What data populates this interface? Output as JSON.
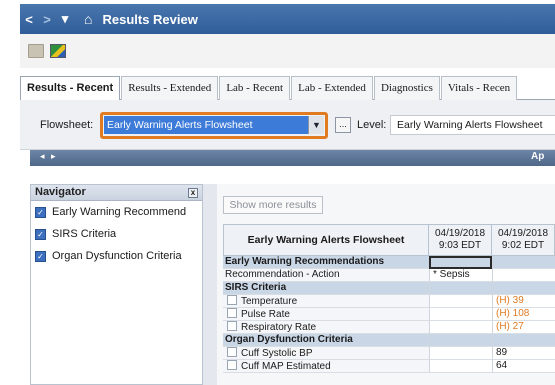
{
  "titlebar": {
    "back_glyph": "<",
    "forward_glyph": ">",
    "menu_glyph": "▾",
    "home_glyph": "⌂",
    "title": "Results Review"
  },
  "tabs": [
    {
      "label": "Results - Recent",
      "active": true
    },
    {
      "label": "Results - Extended",
      "active": false
    },
    {
      "label": "Lab - Recent",
      "active": false
    },
    {
      "label": "Lab - Extended",
      "active": false
    },
    {
      "label": "Diagnostics",
      "active": false
    },
    {
      "label": "Vitals - Recen",
      "active": false
    }
  ],
  "flowsheet": {
    "label": "Flowsheet:",
    "value": "Early Warning Alerts Flowsheet",
    "ellipsis": "...",
    "level_label": "Level:",
    "level_value": "Early Warning Alerts Flowsheet"
  },
  "strip": {
    "arrows": "◂ ▸",
    "right_text": "Ap"
  },
  "navigator": {
    "title": "Navigator",
    "close_glyph": "x",
    "items": [
      {
        "label": "Early Warning Recommend",
        "checked": true
      },
      {
        "label": "SIRS Criteria",
        "checked": true
      },
      {
        "label": "Organ Dysfunction Criteria",
        "checked": true
      }
    ]
  },
  "results": {
    "show_more": "Show more results",
    "header": {
      "name": "Early Warning Alerts Flowsheet",
      "col1": [
        "04/19/2018",
        "9:03 EDT"
      ],
      "col2": [
        "04/19/2018",
        "9:02 EDT"
      ]
    },
    "rows": [
      {
        "type": "section",
        "label": "Early Warning Recommendations",
        "v1": "",
        "v2": ""
      },
      {
        "type": "data",
        "label": "Recommendation - Action",
        "v1": "* Sepsis",
        "v2": ""
      },
      {
        "type": "section",
        "label": "SIRS Criteria",
        "v1": "",
        "v2": ""
      },
      {
        "type": "check",
        "label": "Temperature",
        "v1": "",
        "v2": "(H) 39"
      },
      {
        "type": "check",
        "label": "Pulse Rate",
        "v1": "",
        "v2": "(H) 108"
      },
      {
        "type": "check",
        "label": "Respiratory Rate",
        "v1": "",
        "v2": "(H) 27"
      },
      {
        "type": "section",
        "label": "Organ Dysfunction Criteria",
        "v1": "",
        "v2": ""
      },
      {
        "type": "check",
        "label": "Cuff Systolic BP",
        "v1": "",
        "v2": "89"
      },
      {
        "type": "check",
        "label": "Cuff MAP Estimated",
        "v1": "",
        "v2": "64"
      }
    ]
  },
  "colors": {
    "titlebar": "#3a679f",
    "highlight": "#e07b22",
    "selection": "#3d7bd9",
    "section_row": "#c9d6e6",
    "abnormal": "#e07b22"
  }
}
